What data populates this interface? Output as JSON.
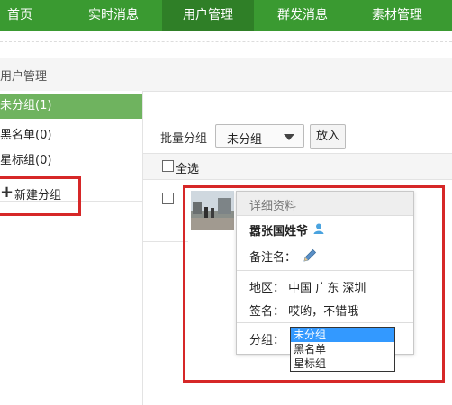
{
  "nav": {
    "tabs": [
      {
        "label": "首页"
      },
      {
        "label": "实时消息"
      },
      {
        "label": "用户管理"
      },
      {
        "label": "群发消息"
      },
      {
        "label": "素材管理"
      }
    ],
    "active": "用户管理"
  },
  "breadcrumb": "用户管理",
  "sidebar": {
    "items": [
      {
        "label": "未分组(1)"
      },
      {
        "label": "黑名单(0)"
      },
      {
        "label": "星标组(0)"
      }
    ],
    "new_group": "新建分组"
  },
  "batch": {
    "label": "批量分组",
    "selected": "未分组",
    "put_button": "放入"
  },
  "select_all": "全选",
  "profile": {
    "header": "详细资料",
    "name": "嚣张国姓爷",
    "remark_label": "备注名：",
    "region": "地区： 中国 广东 深圳",
    "signature": "签名： 哎哟，不错哦",
    "group_label": "分组：",
    "group_options": [
      "未分组",
      "黑名单",
      "星标组"
    ],
    "group_selected": "未分组"
  },
  "colors": {
    "nav_bg": "#3a9a31",
    "nav_active": "#2f7f27",
    "sidebar_active": "#6fb35f",
    "highlight_box": "#d62728",
    "option_selected": "#3399ff"
  },
  "icons": [
    "plus-icon",
    "person-icon",
    "pencil-icon",
    "dropdown-caret-icon"
  ]
}
